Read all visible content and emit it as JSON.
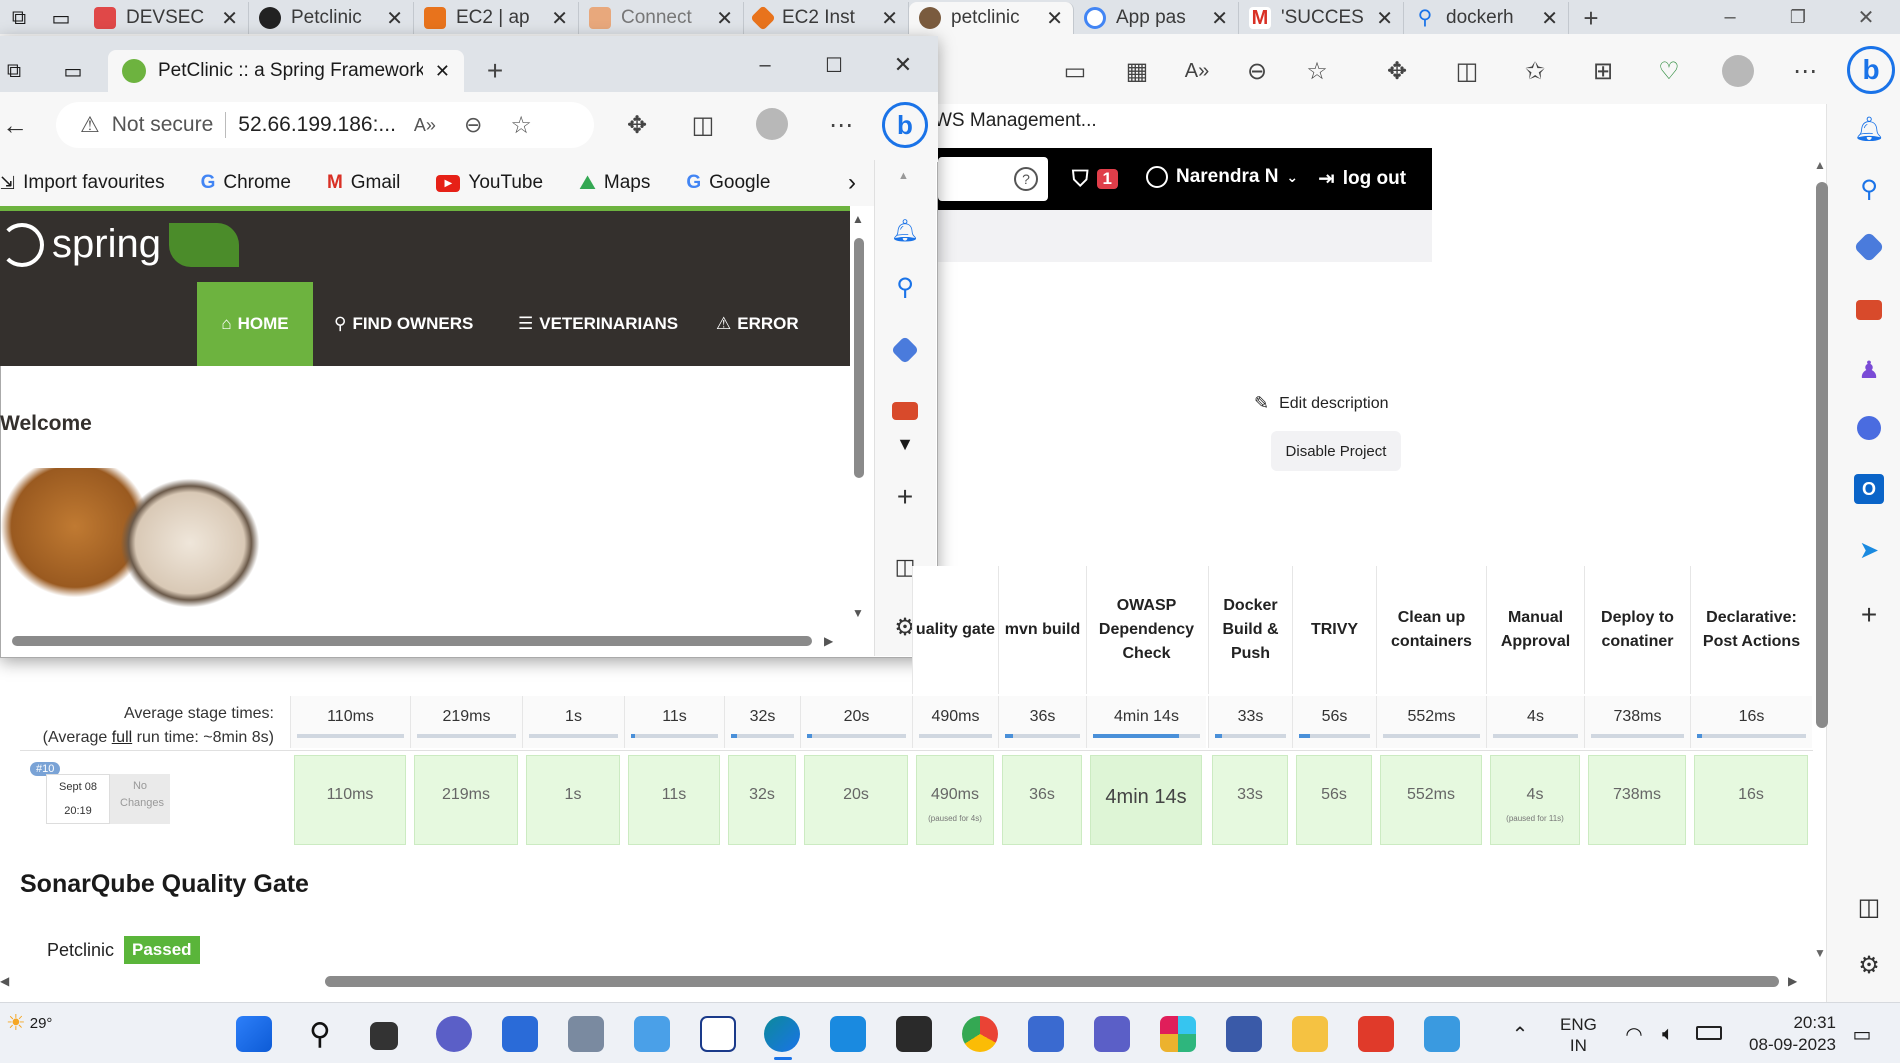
{
  "browser": {
    "tabs": [
      {
        "label": "DEVSEC",
        "color": "#e04848"
      },
      {
        "label": "Petclinic",
        "color": "#222222"
      },
      {
        "label": "EC2 | ap",
        "color": "#e8731c"
      },
      {
        "label": "Connect",
        "color": "#e8731c"
      },
      {
        "label": "EC2 Inst",
        "color": "#e8731c"
      },
      {
        "label": "petclinic",
        "color": "#7a5b3e"
      },
      {
        "label": "App pas",
        "color": "#4285f4"
      },
      {
        "label": "'SUCCES",
        "color": "#d93025"
      },
      {
        "label": "dockerh",
        "color": "#1a73e8"
      }
    ],
    "active_tab_index": 5,
    "aws_tab_text": "WS Management...",
    "toolbar_icons": [
      "app-icon",
      "apps-icon",
      "read-aloud-icon",
      "zoom-out-icon",
      "favorite-icon",
      "extensions-icon",
      "split-screen-icon",
      "favorites-icon",
      "collections-icon",
      "health-icon",
      "profile-icon",
      "more-icon"
    ],
    "bing": "b"
  },
  "jenkins": {
    "header": {
      "help": "?",
      "alert_count": "1",
      "user": "Narendra N",
      "logout": "log out"
    },
    "edit_description": "Edit description",
    "disable_project": "Disable Project",
    "stage_view": {
      "stages": [
        "Quality gate",
        "mvn build",
        "OWASP Dependency Check",
        "Docker Build & Push",
        "TRIVY",
        "Clean up containers",
        "Manual Approval",
        "Deploy to conatiner",
        "Declarative: Post Actions"
      ],
      "stage_headers_visible": [
        "uality gate",
        "mvn build",
        "OWASP Dependency Check",
        "Docker Build & Push",
        "TRIVY",
        "Clean up containers",
        "Manual Approval",
        "Deploy to conatiner",
        "Declarative: Post Actions"
      ],
      "avg_label": "Average stage times:",
      "avg_run_prefix": "(Average ",
      "avg_run_link": "full",
      "avg_run_suffix": " run time: ~8min 8s)",
      "avg_times": [
        "110ms",
        "219ms",
        "1s",
        "11s",
        "32s",
        "20s",
        "490ms",
        "36s",
        "4min 14s",
        "33s",
        "56s",
        "552ms",
        "4s",
        "738ms",
        "16s"
      ],
      "avg_progress": [
        0.0,
        0.0,
        0.0,
        0.05,
        0.1,
        0.05,
        0.0,
        0.1,
        0.8,
        0.1,
        0.15,
        0.0,
        0.0,
        0.0,
        0.05
      ],
      "run": {
        "id": "#10",
        "date": "Sept 08",
        "time": "20:19",
        "changes": "No Changes",
        "times": [
          "110ms",
          "219ms",
          "1s",
          "11s",
          "32s",
          "20s",
          "490ms",
          "36s",
          "4min 14s",
          "33s",
          "56s",
          "552ms",
          "4s",
          "738ms",
          "16s"
        ],
        "notes": [
          "",
          "",
          "",
          "",
          "",
          "",
          "(paused for 4s)",
          "",
          "",
          "",
          "",
          "",
          "(paused for 11s)",
          "",
          ""
        ]
      }
    },
    "sonar": {
      "title": "SonarQube Quality Gate",
      "project": "Petclinic",
      "status": "Passed"
    }
  },
  "popup": {
    "tab_title": "PetClinic :: a Spring Framework d",
    "address_warning": "Not secure",
    "address": "52.66.199.186:...",
    "favorites": [
      "Import favourites",
      "Chrome",
      "Gmail",
      "YouTube",
      "Maps",
      "Google"
    ],
    "site": {
      "logo": "spring",
      "nav": [
        "HOME",
        "FIND OWNERS",
        "VETERINARIANS",
        "ERROR"
      ],
      "welcome": "Welcome"
    }
  },
  "taskbar": {
    "weather": "29°",
    "lang_top": "ENG",
    "lang_bottom": "IN",
    "time": "20:31",
    "date": "08-09-2023"
  }
}
